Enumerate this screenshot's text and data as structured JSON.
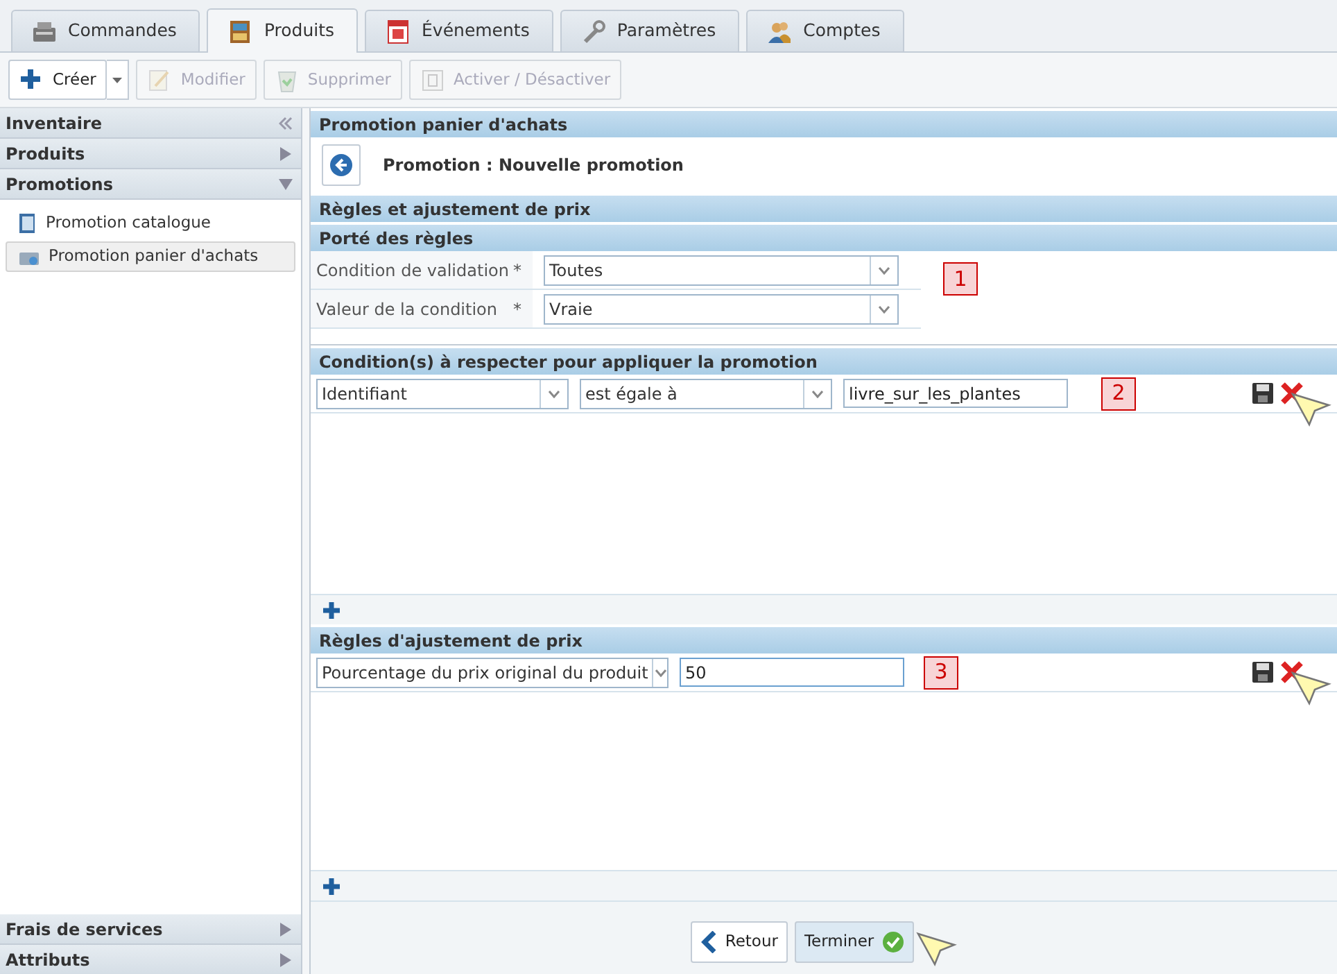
{
  "tabs": [
    {
      "label": "Commandes",
      "selected": false
    },
    {
      "label": "Produits",
      "selected": true
    },
    {
      "label": "Événements",
      "selected": false
    },
    {
      "label": "Paramètres",
      "selected": false
    },
    {
      "label": "Comptes",
      "selected": false
    }
  ],
  "toolbar": [
    {
      "label": "Créer",
      "kind": "split",
      "disabled": false
    },
    {
      "label": "Modifier",
      "kind": "plain",
      "disabled": true
    },
    {
      "label": "Supprimer",
      "kind": "plain",
      "disabled": true
    },
    {
      "label": "Activer / Désactiver",
      "kind": "plain",
      "disabled": true
    }
  ],
  "sidebar": {
    "top": [
      {
        "label": "Inventaire",
        "kind": "collapse"
      },
      {
        "label": "Produits",
        "kind": "section",
        "expanded": false
      },
      {
        "label": "Promotions",
        "kind": "section",
        "expanded": true,
        "children": [
          {
            "label": "Promotion catalogue",
            "selected": false
          },
          {
            "label": "Promotion panier d'achats",
            "selected": true
          }
        ]
      }
    ],
    "bottom": [
      {
        "label": "Frais de services",
        "expanded": false
      },
      {
        "label": "Attributs",
        "expanded": false
      }
    ]
  },
  "panel": {
    "title": "Promotion panier d'achats",
    "subtitle": "Promotion : Nouvelle promotion",
    "section": "Règles et ajustement de prix",
    "scope": {
      "title": "Porté des règles",
      "fields": [
        {
          "label": "Condition de validation",
          "required": "*",
          "value": "Toutes"
        },
        {
          "label": "Valeur de la condition",
          "required": "*",
          "value": "Vraie"
        }
      ],
      "marker": "1"
    },
    "conditions": {
      "title": "Condition(s) à respecter pour appliquer la promotion",
      "rows": [
        {
          "field": "Identifiant",
          "operator": "est égale à",
          "value": "livre_sur_les_plantes",
          "marker": "2"
        }
      ]
    },
    "adjustments": {
      "title": "Règles d'ajustement de prix",
      "rows": [
        {
          "type": "Pourcentage du prix original du produit",
          "value": "50",
          "marker": "3"
        }
      ]
    }
  },
  "footer": {
    "buttons": [
      {
        "label": "Retour",
        "kind": "back"
      },
      {
        "label": "Terminer",
        "kind": "finish"
      }
    ]
  }
}
